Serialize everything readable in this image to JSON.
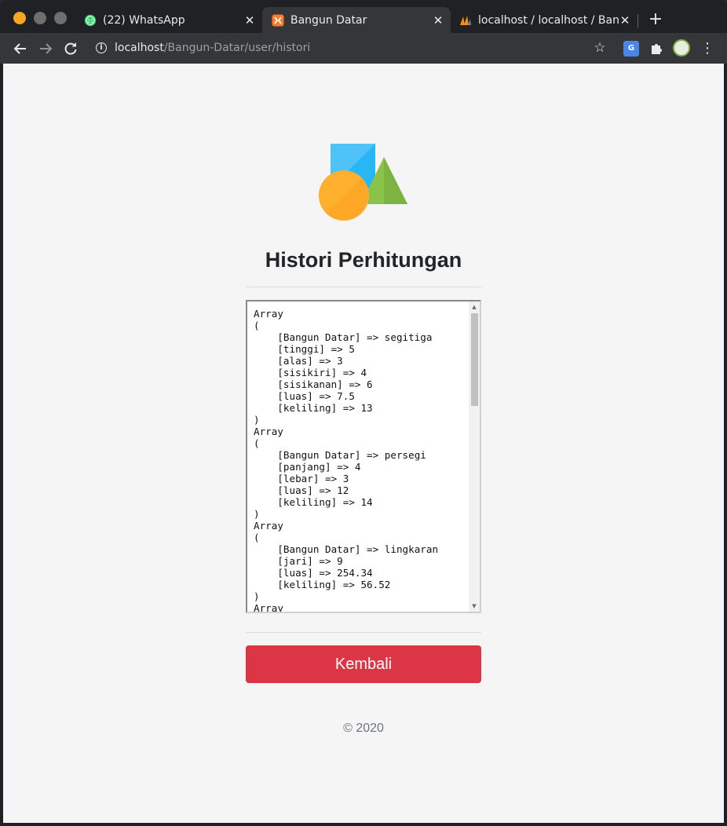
{
  "browser": {
    "tabs": [
      {
        "title": "(22) WhatsApp",
        "badge": "22",
        "icon": "whatsapp-icon",
        "active": false
      },
      {
        "title": "Bangun Datar",
        "icon": "xampp-icon",
        "active": true
      },
      {
        "title": "localhost / localhost / Bangun",
        "icon": "phpmyadmin-icon",
        "active": false
      }
    ],
    "tab_close_glyph": "✕",
    "new_tab_glyph": "+",
    "url_host": "localhost",
    "url_path": "/Bangun-Datar/user/histori",
    "colors": {
      "traffic_close": "#f6a623",
      "frame": "#202124",
      "toolbar": "#35363a"
    }
  },
  "page": {
    "title": "Histori Perhitungan",
    "history_text": "Array\n(\n    [Bangun Datar] => segitiga\n    [tinggi] => 5\n    [alas] => 3\n    [sisikiri] => 4\n    [sisikanan] => 6\n    [luas] => 7.5\n    [keliling] => 13\n)\nArray\n(\n    [Bangun Datar] => persegi\n    [panjang] => 4\n    [lebar] => 3\n    [luas] => 12\n    [keliling] => 14\n)\nArray\n(\n    [Bangun Datar] => lingkaran\n    [jari] => 9\n    [luas] => 254.34\n    [keliling] => 56.52\n)\nArray",
    "back_button": "Kembali",
    "footer": "© 2020",
    "colors": {
      "button": "#dc3545",
      "background": "#f5f5f5"
    }
  }
}
